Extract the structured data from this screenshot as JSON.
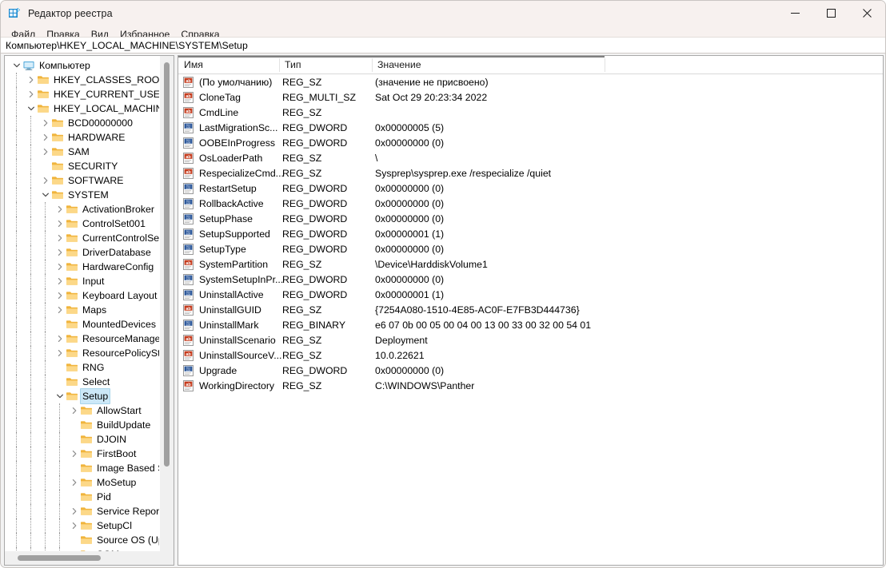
{
  "window": {
    "title": "Редактор реестра",
    "icon": "registry-icon",
    "controls": {
      "minimize": "minimize-icon",
      "maximize": "maximize-icon",
      "close": "close-icon"
    }
  },
  "menubar": {
    "items": [
      {
        "label": "Файл"
      },
      {
        "label": "Правка"
      },
      {
        "label": "Вид"
      },
      {
        "label": "Избранное"
      },
      {
        "label": "Справка"
      }
    ]
  },
  "address": {
    "path": "Компьютер\\HKEY_LOCAL_MACHINE\\SYSTEM\\Setup"
  },
  "tree": {
    "items": [
      {
        "label": "Компьютер",
        "depth": 0,
        "state": "expanded",
        "icon": "computer-icon",
        "selected": false
      },
      {
        "label": "HKEY_CLASSES_ROOT",
        "depth": 1,
        "state": "collapsed",
        "icon": "folder-icon",
        "selected": false
      },
      {
        "label": "HKEY_CURRENT_USER",
        "depth": 1,
        "state": "collapsed",
        "icon": "folder-icon",
        "selected": false
      },
      {
        "label": "HKEY_LOCAL_MACHINE",
        "depth": 1,
        "state": "expanded",
        "icon": "folder-icon",
        "selected": false
      },
      {
        "label": "BCD00000000",
        "depth": 2,
        "state": "collapsed",
        "icon": "folder-icon",
        "selected": false
      },
      {
        "label": "HARDWARE",
        "depth": 2,
        "state": "collapsed",
        "icon": "folder-icon",
        "selected": false
      },
      {
        "label": "SAM",
        "depth": 2,
        "state": "collapsed",
        "icon": "folder-icon",
        "selected": false
      },
      {
        "label": "SECURITY",
        "depth": 2,
        "state": "leaf",
        "icon": "folder-icon",
        "selected": false
      },
      {
        "label": "SOFTWARE",
        "depth": 2,
        "state": "collapsed",
        "icon": "folder-icon",
        "selected": false
      },
      {
        "label": "SYSTEM",
        "depth": 2,
        "state": "expanded",
        "icon": "folder-icon",
        "selected": false
      },
      {
        "label": "ActivationBroker",
        "depth": 3,
        "state": "collapsed",
        "icon": "folder-icon",
        "selected": false
      },
      {
        "label": "ControlSet001",
        "depth": 3,
        "state": "collapsed",
        "icon": "folder-icon",
        "selected": false
      },
      {
        "label": "CurrentControlSet",
        "depth": 3,
        "state": "collapsed",
        "icon": "folder-icon",
        "selected": false
      },
      {
        "label": "DriverDatabase",
        "depth": 3,
        "state": "collapsed",
        "icon": "folder-icon",
        "selected": false
      },
      {
        "label": "HardwareConfig",
        "depth": 3,
        "state": "collapsed",
        "icon": "folder-icon",
        "selected": false
      },
      {
        "label": "Input",
        "depth": 3,
        "state": "collapsed",
        "icon": "folder-icon",
        "selected": false
      },
      {
        "label": "Keyboard Layout",
        "depth": 3,
        "state": "collapsed",
        "icon": "folder-icon",
        "selected": false
      },
      {
        "label": "Maps",
        "depth": 3,
        "state": "collapsed",
        "icon": "folder-icon",
        "selected": false
      },
      {
        "label": "MountedDevices",
        "depth": 3,
        "state": "leaf",
        "icon": "folder-icon",
        "selected": false
      },
      {
        "label": "ResourceManager",
        "depth": 3,
        "state": "collapsed",
        "icon": "folder-icon",
        "selected": false
      },
      {
        "label": "ResourcePolicyStore",
        "depth": 3,
        "state": "collapsed",
        "icon": "folder-icon",
        "selected": false
      },
      {
        "label": "RNG",
        "depth": 3,
        "state": "leaf",
        "icon": "folder-icon",
        "selected": false
      },
      {
        "label": "Select",
        "depth": 3,
        "state": "leaf",
        "icon": "folder-icon",
        "selected": false
      },
      {
        "label": "Setup",
        "depth": 3,
        "state": "expanded",
        "icon": "folder-icon",
        "selected": true
      },
      {
        "label": "AllowStart",
        "depth": 4,
        "state": "collapsed",
        "icon": "folder-icon",
        "selected": false
      },
      {
        "label": "BuildUpdate",
        "depth": 4,
        "state": "leaf",
        "icon": "folder-icon",
        "selected": false
      },
      {
        "label": "DJOIN",
        "depth": 4,
        "state": "leaf",
        "icon": "folder-icon",
        "selected": false
      },
      {
        "label": "FirstBoot",
        "depth": 4,
        "state": "collapsed",
        "icon": "folder-icon",
        "selected": false
      },
      {
        "label": "Image Based Setup",
        "depth": 4,
        "state": "leaf",
        "icon": "folder-icon",
        "selected": false
      },
      {
        "label": "MoSetup",
        "depth": 4,
        "state": "collapsed",
        "icon": "folder-icon",
        "selected": false
      },
      {
        "label": "Pid",
        "depth": 4,
        "state": "leaf",
        "icon": "folder-icon",
        "selected": false
      },
      {
        "label": "Service Reporting API",
        "depth": 4,
        "state": "collapsed",
        "icon": "folder-icon",
        "selected": false
      },
      {
        "label": "SetupCl",
        "depth": 4,
        "state": "collapsed",
        "icon": "folder-icon",
        "selected": false
      },
      {
        "label": "Source OS (Updated o",
        "depth": 4,
        "state": "leaf",
        "icon": "folder-icon",
        "selected": false
      },
      {
        "label": "SQM",
        "depth": 4,
        "state": "collapsed",
        "icon": "folder-icon",
        "selected": false
      }
    ]
  },
  "list": {
    "columns": [
      {
        "label": "Имя"
      },
      {
        "label": "Тип"
      },
      {
        "label": "Значение"
      }
    ],
    "rows": [
      {
        "name": "(По умолчанию)",
        "type": "REG_SZ",
        "value": "(значение не присвоено)",
        "icon": "string-value-icon"
      },
      {
        "name": "CloneTag",
        "type": "REG_MULTI_SZ",
        "value": "Sat Oct 29 20:23:34 2022",
        "icon": "string-value-icon"
      },
      {
        "name": "CmdLine",
        "type": "REG_SZ",
        "value": "",
        "icon": "string-value-icon"
      },
      {
        "name": "LastMigrationSc...",
        "type": "REG_DWORD",
        "value": "0x00000005 (5)",
        "icon": "binary-value-icon"
      },
      {
        "name": "OOBEInProgress",
        "type": "REG_DWORD",
        "value": "0x00000000 (0)",
        "icon": "binary-value-icon"
      },
      {
        "name": "OsLoaderPath",
        "type": "REG_SZ",
        "value": "\\",
        "icon": "string-value-icon"
      },
      {
        "name": "RespecializeCmd...",
        "type": "REG_SZ",
        "value": "Sysprep\\sysprep.exe /respecialize /quiet",
        "icon": "string-value-icon"
      },
      {
        "name": "RestartSetup",
        "type": "REG_DWORD",
        "value": "0x00000000 (0)",
        "icon": "binary-value-icon"
      },
      {
        "name": "RollbackActive",
        "type": "REG_DWORD",
        "value": "0x00000000 (0)",
        "icon": "binary-value-icon"
      },
      {
        "name": "SetupPhase",
        "type": "REG_DWORD",
        "value": "0x00000000 (0)",
        "icon": "binary-value-icon"
      },
      {
        "name": "SetupSupported",
        "type": "REG_DWORD",
        "value": "0x00000001 (1)",
        "icon": "binary-value-icon"
      },
      {
        "name": "SetupType",
        "type": "REG_DWORD",
        "value": "0x00000000 (0)",
        "icon": "binary-value-icon"
      },
      {
        "name": "SystemPartition",
        "type": "REG_SZ",
        "value": "\\Device\\HarddiskVolume1",
        "icon": "string-value-icon"
      },
      {
        "name": "SystemSetupInPr...",
        "type": "REG_DWORD",
        "value": "0x00000000 (0)",
        "icon": "binary-value-icon"
      },
      {
        "name": "UninstallActive",
        "type": "REG_DWORD",
        "value": "0x00000001 (1)",
        "icon": "binary-value-icon"
      },
      {
        "name": "UninstallGUID",
        "type": "REG_SZ",
        "value": "{7254A080-1510-4E85-AC0F-E7FB3D444736}",
        "icon": "string-value-icon"
      },
      {
        "name": "UninstallMark",
        "type": "REG_BINARY",
        "value": "e6 07 0b 00 05 00 04 00 13 00 33 00 32 00 54 01",
        "icon": "binary-value-icon"
      },
      {
        "name": "UninstallScenario",
        "type": "REG_SZ",
        "value": "Deployment",
        "icon": "string-value-icon"
      },
      {
        "name": "UninstallSourceV...",
        "type": "REG_SZ",
        "value": "10.0.22621",
        "icon": "string-value-icon"
      },
      {
        "name": "Upgrade",
        "type": "REG_DWORD",
        "value": "0x00000000 (0)",
        "icon": "binary-value-icon"
      },
      {
        "name": "WorkingDirectory",
        "type": "REG_SZ",
        "value": "C:\\WINDOWS\\Panther",
        "icon": "string-value-icon"
      }
    ]
  },
  "colors": {
    "titlebar": "#f7f1ef",
    "selection": "#cce8f7",
    "folder": "#fcc75b",
    "accent": "#0078d4",
    "string_icon": "#c43b1d",
    "binary_icon": "#2b579a"
  }
}
